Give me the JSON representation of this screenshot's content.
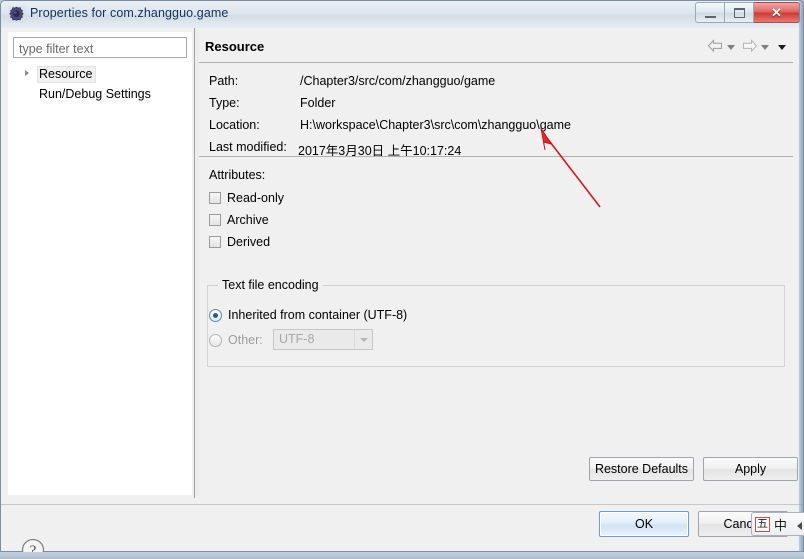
{
  "window": {
    "title": "Properties for com.zhangguo.game",
    "icon": "properties-gear-icon",
    "buttons": {
      "minimize": "minimize-icon",
      "maximize": "restore-icon",
      "close": "✕"
    }
  },
  "sidebar": {
    "filter": {
      "placeholder": "type filter text",
      "value": ""
    },
    "items": [
      {
        "label": "Resource",
        "selected": true,
        "expandable": true
      },
      {
        "label": "Run/Debug Settings",
        "selected": false,
        "expandable": false
      }
    ]
  },
  "main": {
    "title": "Resource",
    "nav": {
      "back": "back-arrow-icon",
      "back_menu": "chevron-down-icon",
      "forward": "forward-arrow-icon",
      "forward_menu": "chevron-down-icon",
      "view_menu": "chevron-down-icon"
    },
    "properties": [
      {
        "label": "Path:",
        "value": "/Chapter3/src/com/zhangguo/game"
      },
      {
        "label": "Type:",
        "value": "Folder"
      },
      {
        "label": "Location:",
        "value": "H:\\workspace\\Chapter3\\src\\com\\zhangguo\\game"
      },
      {
        "label": "Last modified:",
        "value": "2017年3月30日 上午10:17:24"
      }
    ],
    "attributes": {
      "title": "Attributes:",
      "checkboxes": [
        {
          "label": "Read-only",
          "checked": false
        },
        {
          "label": "Archive",
          "checked": false
        },
        {
          "label": "Derived",
          "checked": false
        }
      ]
    },
    "encoding": {
      "group_title": "Text file encoding",
      "inherited_label": "Inherited from container (UTF-8)",
      "inherited_selected": true,
      "other_label": "Other:",
      "other_selected": false,
      "other_value": "UTF-8",
      "other_enabled": false
    },
    "buttons": {
      "restore_defaults": "Restore Defaults",
      "apply": "Apply"
    }
  },
  "footer": {
    "help": "help-icon",
    "ok": "OK",
    "cancel": "Cancel"
  },
  "ime": {
    "mode_icon": "五",
    "language": "中",
    "expand": "triangle-left-icon"
  },
  "annotation": {
    "type": "red-arrow",
    "color": "#d4191f",
    "points_at": "Location value"
  },
  "colors": {
    "accent": "#1f5c9e",
    "title_text": "#13305a",
    "close_red": "#cf3b35",
    "annotation_red": "#d4191f"
  }
}
